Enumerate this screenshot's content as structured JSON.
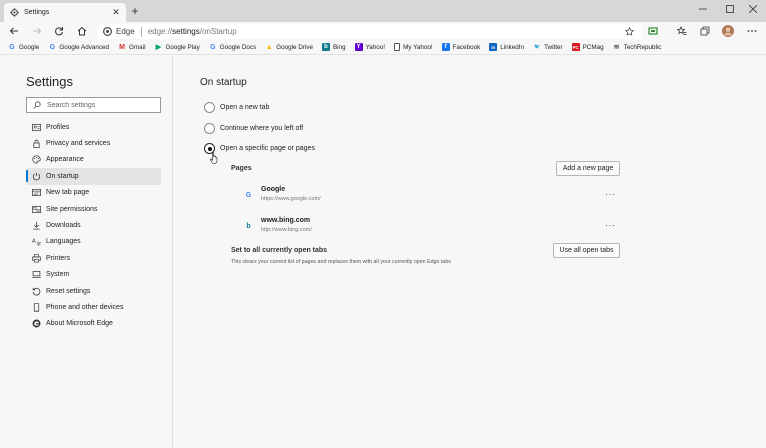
{
  "tab": {
    "title": "Settings"
  },
  "address": {
    "site_label": "Edge",
    "url_prefix": "edge://",
    "url_bold": "settings",
    "url_rest": "/onStartup"
  },
  "favorites": [
    {
      "label": "Google",
      "icon": "google-icon",
      "color": "#4285f4"
    },
    {
      "label": "Google Advanced",
      "icon": "google-icon",
      "color": "#4285f4"
    },
    {
      "label": "Gmail",
      "icon": "gmail-icon",
      "color": "#d93025"
    },
    {
      "label": "Google Play",
      "icon": "play-icon",
      "color": "#00a173"
    },
    {
      "label": "Google Docs",
      "icon": "google-icon",
      "color": "#4285f4"
    },
    {
      "label": "Google Drive",
      "icon": "drive-icon",
      "color": "#f4b400"
    },
    {
      "label": "Bing",
      "icon": "bing-icon",
      "color": "#0f7b8f"
    },
    {
      "label": "Yahoo!",
      "icon": "yahoo-icon",
      "color": "#6001d2"
    },
    {
      "label": "My Yahoo!",
      "icon": "page-icon",
      "color": "#555555"
    },
    {
      "label": "Facebook",
      "icon": "facebook-icon",
      "color": "#1877f2"
    },
    {
      "label": "LinkedIn",
      "icon": "linkedin-icon",
      "color": "#0a66c2"
    },
    {
      "label": "Twitter",
      "icon": "twitter-icon",
      "color": "#1da1f2"
    },
    {
      "label": "PCMag",
      "icon": "pcmag-icon",
      "color": "#d71920"
    },
    {
      "label": "TechRepublic",
      "icon": "techrepublic-icon",
      "color": "#555555"
    }
  ],
  "sidebar": {
    "title": "Settings",
    "search_placeholder": "Search settings",
    "items": [
      {
        "label": "Profiles",
        "icon": "profile-icon",
        "active": false
      },
      {
        "label": "Privacy and services",
        "icon": "lock-icon",
        "active": false
      },
      {
        "label": "Appearance",
        "icon": "appearance-icon",
        "active": false
      },
      {
        "label": "On startup",
        "icon": "power-icon",
        "active": true
      },
      {
        "label": "New tab page",
        "icon": "new-tab-icon",
        "active": false
      },
      {
        "label": "Site permissions",
        "icon": "permissions-icon",
        "active": false
      },
      {
        "label": "Downloads",
        "icon": "download-icon",
        "active": false
      },
      {
        "label": "Languages",
        "icon": "languages-icon",
        "active": false
      },
      {
        "label": "Printers",
        "icon": "printer-icon",
        "active": false
      },
      {
        "label": "System",
        "icon": "system-icon",
        "active": false
      },
      {
        "label": "Reset settings",
        "icon": "reset-icon",
        "active": false
      },
      {
        "label": "Phone and other devices",
        "icon": "phone-icon",
        "active": false
      },
      {
        "label": "About Microsoft Edge",
        "icon": "edge-icon",
        "active": false
      }
    ]
  },
  "main": {
    "title": "On startup",
    "options": [
      {
        "label": "Open a new tab",
        "checked": false
      },
      {
        "label": "Continue where you left off",
        "checked": false
      },
      {
        "label": "Open a specific page or pages",
        "checked": true
      }
    ],
    "pages_label": "Pages",
    "add_page_label": "Add a new page",
    "pages": [
      {
        "name": "Google",
        "url": "https://www.google.com/",
        "icon": "google-icon"
      },
      {
        "name": "www.bing.com",
        "url": "http://www.bing.com/",
        "icon": "bing-icon"
      }
    ],
    "more_label": "···",
    "open_tabs_title": "Set to all currently open tabs",
    "open_tabs_desc": "This clears your current list of pages and replaces them with all your currently open Edge tabs",
    "use_open_tabs_label": "Use all open tabs"
  }
}
